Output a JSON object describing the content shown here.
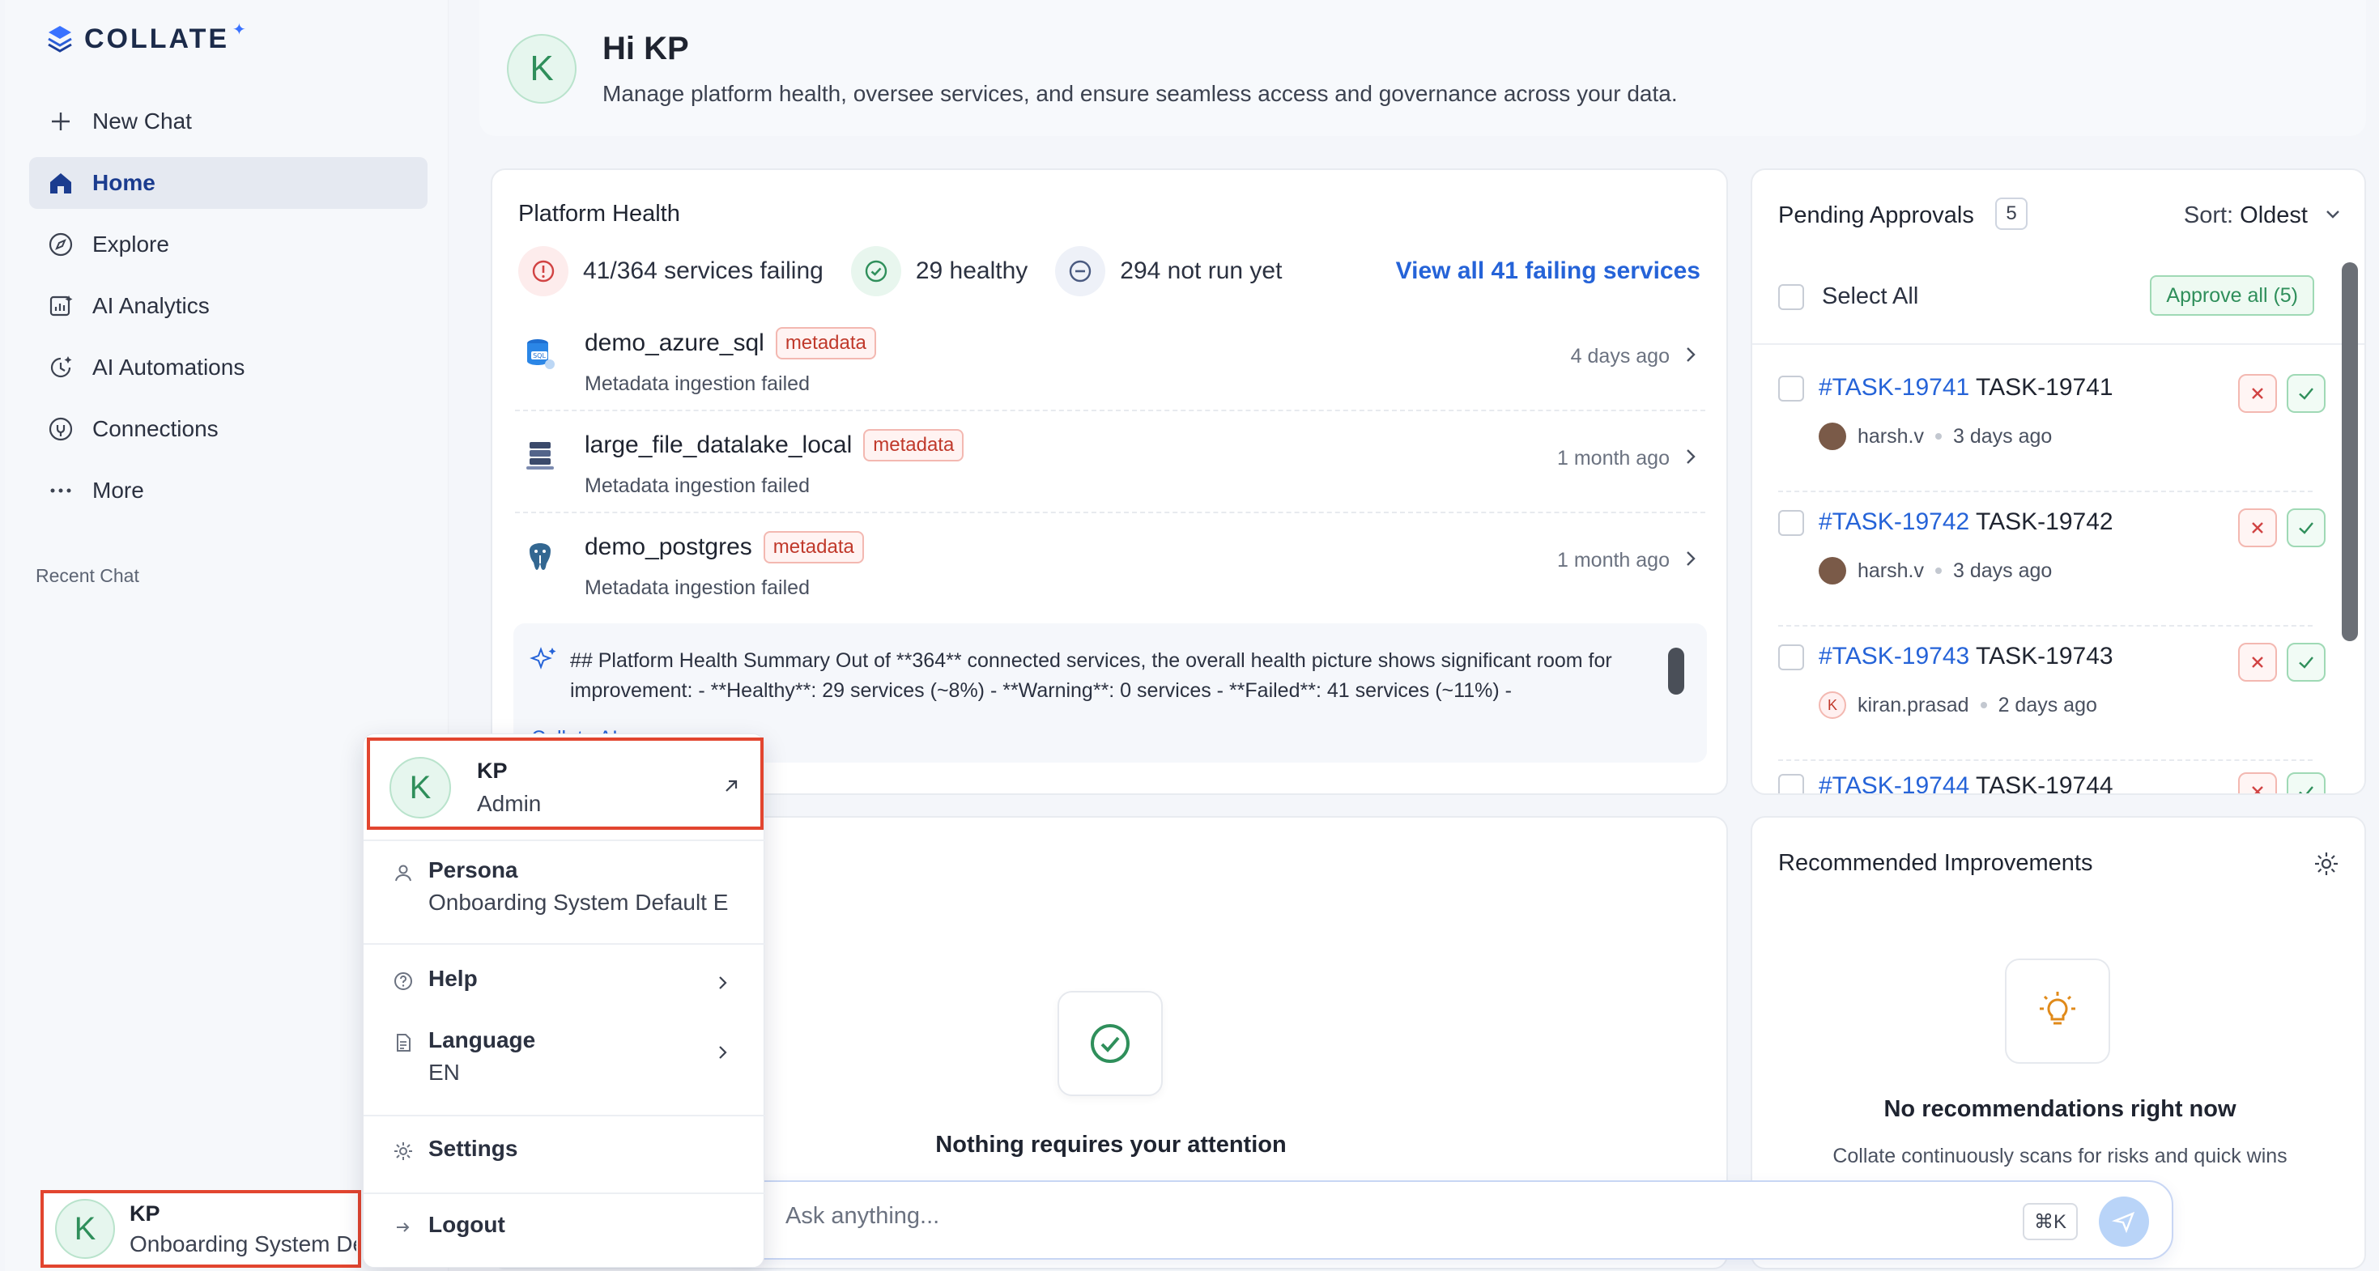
{
  "app": {
    "logo_text": "COLLATE",
    "logo_star": "✦"
  },
  "sidebar": {
    "items": [
      {
        "label": "New Chat",
        "icon": "plus-icon"
      },
      {
        "label": "Home",
        "icon": "home-icon"
      },
      {
        "label": "Explore",
        "icon": "compass-icon"
      },
      {
        "label": "AI Analytics",
        "icon": "analytics-icon"
      },
      {
        "label": "AI Automations",
        "icon": "automation-icon"
      },
      {
        "label": "Connections",
        "icon": "connections-icon"
      },
      {
        "label": "More",
        "icon": "more-dots-icon"
      }
    ],
    "recent_label": "Recent Chat",
    "user": {
      "initial": "K",
      "name": "KP",
      "persona": "Onboarding System Default E"
    }
  },
  "greeting": {
    "initial": "K",
    "title": "Hi KP",
    "subtitle": "Manage platform health, oversee services, and ensure seamless access and governance across your data."
  },
  "platform_health": {
    "title": "Platform Health",
    "failing": "41/364 services failing",
    "healthy": "29 healthy",
    "not_run": "294 not run yet",
    "view_all": "View all 41 failing services",
    "services": [
      {
        "name": "demo_azure_sql",
        "badge": "metadata",
        "desc": "Metadata ingestion failed",
        "time": "4 days ago"
      },
      {
        "name": "large_file_datalake_local",
        "badge": "metadata",
        "desc": "Metadata ingestion failed",
        "time": "1 month ago"
      },
      {
        "name": "demo_postgres",
        "badge": "metadata",
        "desc": "Metadata ingestion failed",
        "time": "1 month ago"
      }
    ],
    "summary": "## Platform Health Summary Out of **364** connected services, the overall health picture shows significant room for improvement: - **Healthy**: 29 services (~8%) - **Warning**: 0 services - **Failed**: 41 services (~11%) -",
    "summary_link": "Collate AI"
  },
  "pending": {
    "title": "Pending Approvals",
    "count": "5",
    "sort_label": "Sort:",
    "sort_value": "Oldest",
    "select_all": "Select All",
    "approve_all": "Approve all (5)",
    "tasks": [
      {
        "id": "#TASK-19741",
        "name": "TASK-19741",
        "user": "harsh.v",
        "time": "3 days ago",
        "avatar": ""
      },
      {
        "id": "#TASK-19742",
        "name": "TASK-19742",
        "user": "harsh.v",
        "time": "3 days ago",
        "avatar": ""
      },
      {
        "id": "#TASK-19743",
        "name": "TASK-19743",
        "user": "kiran.prasad",
        "time": "2 days ago",
        "avatar": "K"
      },
      {
        "id": "#TASK-19744",
        "name": "TASK-19744",
        "user": "",
        "time": "",
        "avatar": ""
      }
    ]
  },
  "attention": {
    "text": "Nothing requires your attention"
  },
  "recommended": {
    "title": "Recommended Improvements",
    "empty_title": "No recommendations right now",
    "empty_sub": "Collate continuously scans for risks and quick wins"
  },
  "ask": {
    "placeholder": "Ask anything...",
    "shortcut": "⌘K"
  },
  "menu": {
    "initial": "K",
    "name": "KP",
    "role": "Admin",
    "persona_label": "Persona",
    "persona_value": "Onboarding System Default E",
    "help_label": "Help",
    "language_label": "Language",
    "language_value": "EN",
    "settings_label": "Settings",
    "logout_label": "Logout"
  },
  "colors": {
    "accent": "#2563d8",
    "danger": "#e2452f",
    "success": "#2f8f5b"
  }
}
